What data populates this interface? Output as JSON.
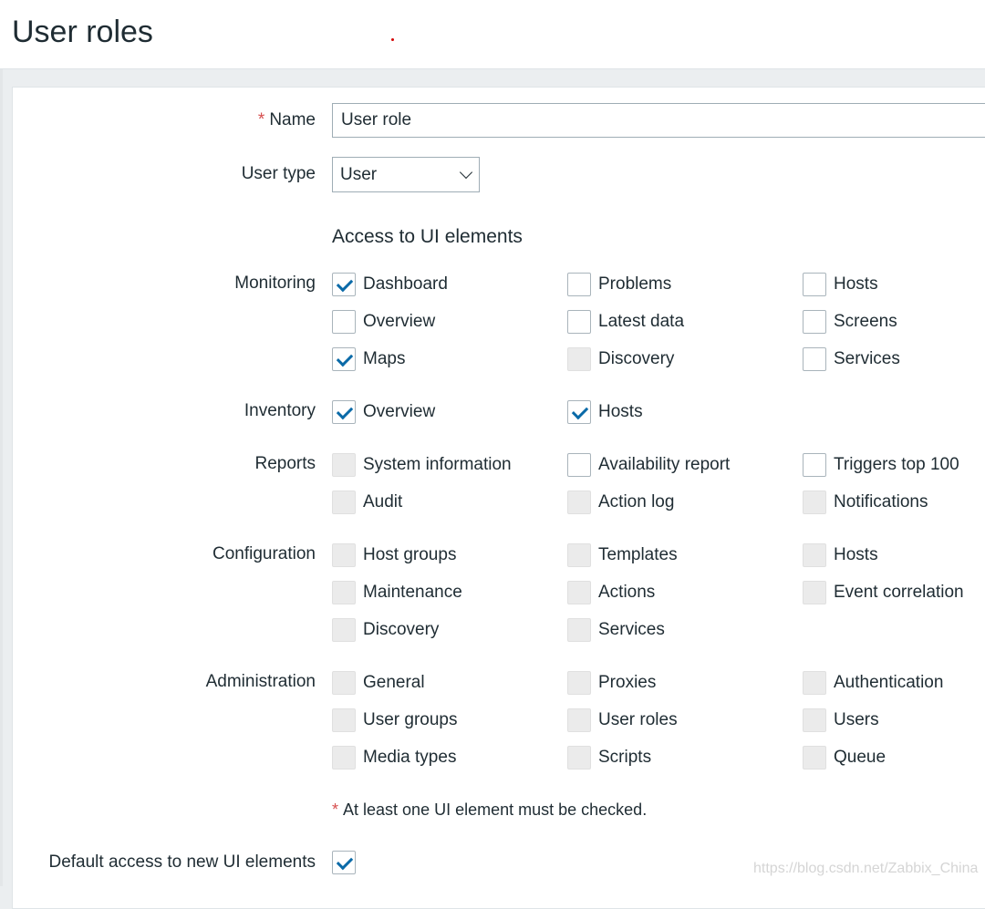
{
  "page_title": "User roles",
  "form": {
    "name_label": "Name",
    "required_mark": "*",
    "name_value": "User role",
    "user_type_label": "User type",
    "user_type_value": "User",
    "section_title": "Access to UI elements",
    "groups": [
      {
        "label": "Monitoring",
        "items": [
          {
            "label": "Dashboard",
            "state": "checked"
          },
          {
            "label": "Problems",
            "state": "unchecked"
          },
          {
            "label": "Hosts",
            "state": "unchecked"
          },
          {
            "label": "Overview",
            "state": "unchecked"
          },
          {
            "label": "Latest data",
            "state": "unchecked"
          },
          {
            "label": "Screens",
            "state": "unchecked"
          },
          {
            "label": "Maps",
            "state": "checked"
          },
          {
            "label": "Discovery",
            "state": "disabled"
          },
          {
            "label": "Services",
            "state": "unchecked"
          }
        ]
      },
      {
        "label": "Inventory",
        "items": [
          {
            "label": "Overview",
            "state": "checked"
          },
          {
            "label": "Hosts",
            "state": "checked"
          }
        ]
      },
      {
        "label": "Reports",
        "items": [
          {
            "label": "System information",
            "state": "disabled"
          },
          {
            "label": "Availability report",
            "state": "unchecked"
          },
          {
            "label": "Triggers top 100",
            "state": "unchecked"
          },
          {
            "label": "Audit",
            "state": "disabled"
          },
          {
            "label": "Action log",
            "state": "disabled"
          },
          {
            "label": "Notifications",
            "state": "disabled"
          }
        ]
      },
      {
        "label": "Configuration",
        "items": [
          {
            "label": "Host groups",
            "state": "disabled"
          },
          {
            "label": "Templates",
            "state": "disabled"
          },
          {
            "label": "Hosts",
            "state": "disabled"
          },
          {
            "label": "Maintenance",
            "state": "disabled"
          },
          {
            "label": "Actions",
            "state": "disabled"
          },
          {
            "label": "Event correlation",
            "state": "disabled"
          },
          {
            "label": "Discovery",
            "state": "disabled"
          },
          {
            "label": "Services",
            "state": "disabled"
          }
        ]
      },
      {
        "label": "Administration",
        "items": [
          {
            "label": "General",
            "state": "disabled"
          },
          {
            "label": "Proxies",
            "state": "disabled"
          },
          {
            "label": "Authentication",
            "state": "disabled"
          },
          {
            "label": "User groups",
            "state": "disabled"
          },
          {
            "label": "User roles",
            "state": "disabled"
          },
          {
            "label": "Users",
            "state": "disabled"
          },
          {
            "label": "Media types",
            "state": "disabled"
          },
          {
            "label": "Scripts",
            "state": "disabled"
          },
          {
            "label": "Queue",
            "state": "disabled"
          }
        ]
      }
    ],
    "note": "At least one UI element must be checked.",
    "default_access_label": "Default access to new UI elements",
    "default_access_checked": true
  },
  "watermark": "https://blog.csdn.net/Zabbix_China",
  "colors": {
    "accent": "#0a6aa8",
    "required": "#d64e4e"
  }
}
